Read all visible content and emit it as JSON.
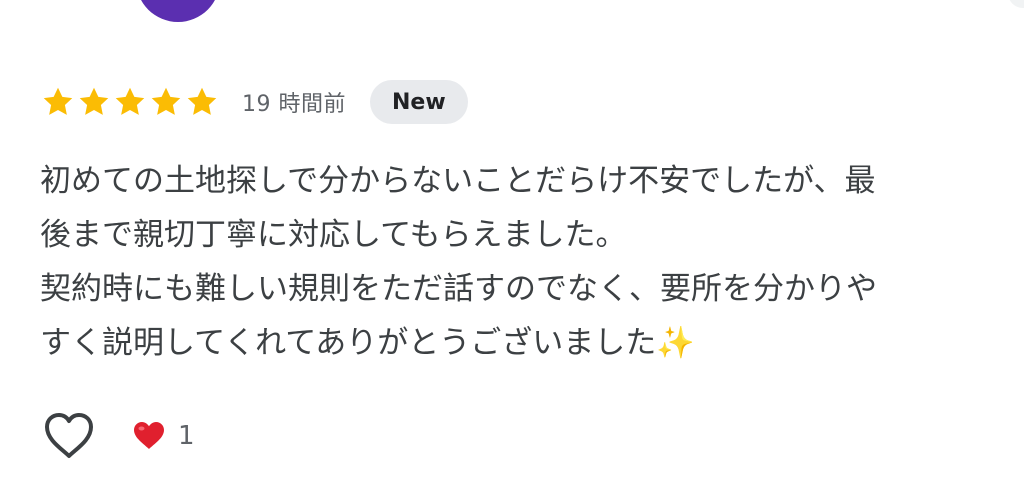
{
  "review": {
    "rating": 5,
    "max_rating": 5,
    "timestamp": "19 時間前",
    "badge": "New",
    "text": "初めての土地探しで分からないことだらけ不安でしたが、最\n後まで親切丁寧に対応してもらえました。\n契約時にも難しい規則をただ話すのでなく、要所を分かりや\nすく説明してくれてありがとうございました✨"
  },
  "reactions": {
    "icon": "red-heart-icon",
    "count": "1"
  },
  "icons": {
    "star": "star-icon",
    "like": "heart-outline-icon"
  },
  "colors": {
    "star": "#fbbc04",
    "avatar": "#5b2fb0",
    "badge_bg": "#e8eaed",
    "heart_red": "#e0202e"
  }
}
